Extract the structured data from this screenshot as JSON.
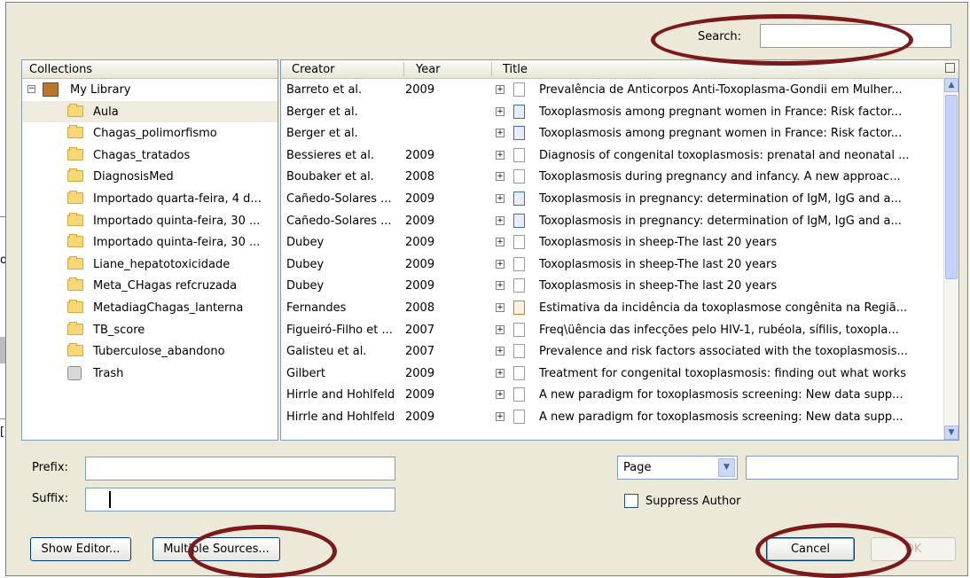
{
  "search": {
    "label": "Search:",
    "value": ""
  },
  "collections": {
    "header": "Collections",
    "items": [
      {
        "label": "My Library",
        "type": "library",
        "selected": false
      },
      {
        "label": "Aula",
        "type": "folder",
        "selected": true
      },
      {
        "label": "Chagas_polimorfismo",
        "type": "folder",
        "selected": false
      },
      {
        "label": "Chagas_tratados",
        "type": "folder",
        "selected": false
      },
      {
        "label": "DiagnosisMed",
        "type": "folder",
        "selected": false
      },
      {
        "label": "Importado quarta-feira, 4 d...",
        "type": "folder",
        "selected": false
      },
      {
        "label": "Importado quinta-feira, 30 ...",
        "type": "folder",
        "selected": false
      },
      {
        "label": "Importado quinta-feira, 30 ...",
        "type": "folder",
        "selected": false
      },
      {
        "label": "Liane_hepatotoxicidade",
        "type": "folder",
        "selected": false
      },
      {
        "label": "Meta_CHagas refcruzada",
        "type": "folder",
        "selected": false
      },
      {
        "label": "MetadiagChagas_lanterna",
        "type": "folder",
        "selected": false
      },
      {
        "label": "TB_score",
        "type": "folder",
        "selected": false
      },
      {
        "label": "Tuberculose_abandono",
        "type": "folder",
        "selected": false
      },
      {
        "label": "Trash",
        "type": "trash",
        "selected": false
      }
    ]
  },
  "items": {
    "headers": {
      "creator": "Creator",
      "year": "Year",
      "title": "Title"
    },
    "rows": [
      {
        "creator": "Barreto et al.",
        "year": "2009",
        "title": "Prevalência de Anticorpos Anti-Toxoplasma-Gondii em Mulher...",
        "icon": "document"
      },
      {
        "creator": "Berger et al.",
        "year": "",
        "title": "Toxoplasmosis among pregnant women in France: Risk factor...",
        "icon": "book"
      },
      {
        "creator": "Berger et al.",
        "year": "",
        "title": "Toxoplasmosis among pregnant women in France: Risk factor...",
        "icon": "book"
      },
      {
        "creator": "Bessieres et al.",
        "year": "2009",
        "title": "Diagnosis of congenital toxoplasmosis: prenatal and neonatal ...",
        "icon": "document"
      },
      {
        "creator": "Boubaker et al.",
        "year": "2008",
        "title": "Toxoplasmosis during pregnancy and infancy. A new approac...",
        "icon": "document"
      },
      {
        "creator": "Cañedo-Solares ...",
        "year": "2009",
        "title": "Toxoplasmosis in pregnancy: determination of IgM, IgG and a...",
        "icon": "book"
      },
      {
        "creator": "Cañedo-Solares ...",
        "year": "2009",
        "title": "Toxoplasmosis in pregnancy: determination of IgM, IgG and a...",
        "icon": "book"
      },
      {
        "creator": "Dubey",
        "year": "2009",
        "title": "Toxoplasmosis in sheep-The last 20 years",
        "icon": "document"
      },
      {
        "creator": "Dubey",
        "year": "2009",
        "title": "Toxoplasmosis in sheep-The last 20 years",
        "icon": "document"
      },
      {
        "creator": "Dubey",
        "year": "2009",
        "title": "Toxoplasmosis in sheep-The last 20 years",
        "icon": "document"
      },
      {
        "creator": "Fernandes",
        "year": "2008",
        "title": "Estimativa da incidência da toxoplasmose congênita na Regiã...",
        "icon": "report"
      },
      {
        "creator": "Figueiró-Filho et ...",
        "year": "2007",
        "title": "Freq\\üência das infecções pelo HIV-1, rubéola, sífilis, toxopla...",
        "icon": "document"
      },
      {
        "creator": "Galisteu et al.",
        "year": "2007",
        "title": "Prevalence and risk factors associated with the toxoplasmosis...",
        "icon": "document"
      },
      {
        "creator": "Gilbert",
        "year": "2009",
        "title": "Treatment for congenital toxoplasmosis: finding out what works",
        "icon": "document"
      },
      {
        "creator": "Hirrle and Hohlfeld",
        "year": "2009",
        "title": "A new paradigm for toxoplasmosis screening: New data supp...",
        "icon": "document"
      },
      {
        "creator": "Hirrle and Hohlfeld",
        "year": "2009",
        "title": "A new paradigm for toxoplasmosis screening: New data supp...",
        "icon": "document"
      }
    ]
  },
  "prefix": {
    "label": "Prefix:",
    "value": ""
  },
  "suffix": {
    "label": "Suffix:",
    "value": ""
  },
  "locator": {
    "selected": "Page",
    "value": ""
  },
  "suppress_author": {
    "label": "Suppress Author",
    "checked": false
  },
  "buttons": {
    "show_editor": "Show Editor...",
    "multiple_sources": "Multiple Sources...",
    "cancel": "Cancel",
    "ok": "OK"
  },
  "background_text": {
    "char1": "o",
    "char2": "[("
  }
}
